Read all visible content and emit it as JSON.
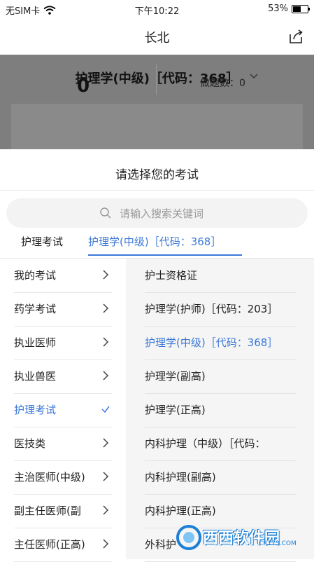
{
  "status": {
    "carrier": "无SIM卡",
    "time": "下午10:22",
    "battery": "53%",
    "battery_level": 0.53
  },
  "nav": {
    "title": "长北"
  },
  "background": {
    "exam_title": "护理学(中级)［代码：368］",
    "big_number": "0",
    "count_label": "做题数：0"
  },
  "sheet": {
    "title": "请选择您的考试",
    "search_placeholder": "请输入搜索关键词",
    "tabs": [
      {
        "label": "护理考试"
      },
      {
        "label": "护理学(中级)［代码：368］"
      }
    ],
    "categories": [
      {
        "label": "我的考试"
      },
      {
        "label": "药学考试"
      },
      {
        "label": "执业医师"
      },
      {
        "label": "执业兽医"
      },
      {
        "label": "护理考试"
      },
      {
        "label": "医技类"
      },
      {
        "label": "主治医师(中级)"
      },
      {
        "label": "副主任医师(副"
      },
      {
        "label": "主任医师(正高)"
      }
    ],
    "exams": [
      {
        "label": "护士资格证"
      },
      {
        "label": "护理学(护师)［代码：203］"
      },
      {
        "label": "护理学(中级)［代码：368］"
      },
      {
        "label": "护理学(副高)"
      },
      {
        "label": "护理学(正高)"
      },
      {
        "label": "内科护理（中级）［代码："
      },
      {
        "label": "内科护理(副高)"
      },
      {
        "label": "内科护理(正高)"
      },
      {
        "label": "外科护"
      }
    ]
  },
  "watermark": {
    "text": "西西软件园",
    "sub": "CR173.COM"
  },
  "colors": {
    "accent": "#3b78d8"
  }
}
